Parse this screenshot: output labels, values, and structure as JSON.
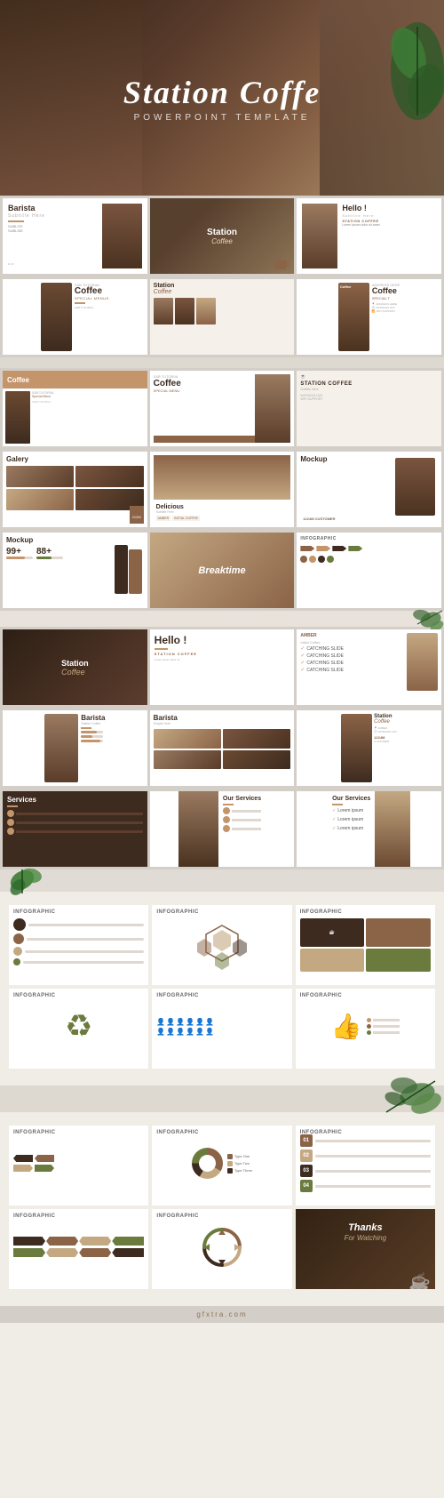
{
  "hero": {
    "title": "Station Coffe",
    "subtitle": "POWERPOINT TEMPLATE",
    "brand": "gfxtra.com"
  },
  "slides": {
    "row1": [
      {
        "id": "barista",
        "title": "Barista",
        "subtitle": "Subtitle Here",
        "tag1": "SUBLITE",
        "tag2": "SUBLISE"
      },
      {
        "id": "station-main",
        "title": "Station",
        "subtitle": "Coffee"
      },
      {
        "id": "hello",
        "title": "Hello",
        "subtitle": "Subtitle Here",
        "tag": "STATION COFFEE"
      }
    ],
    "row2": [
      {
        "id": "coffee-special",
        "title": "Coffee",
        "subtitle": "SPECIAL MENUS",
        "tag": "S&B TUTORIAL"
      },
      {
        "id": "station-coffee2",
        "title": "Station",
        "subtitle": "Coffee"
      },
      {
        "id": "coffee-address",
        "title": "Coffee",
        "subtitle": "SPECIAL T",
        "tag": "ADDRESS HERE"
      }
    ],
    "row3": [
      {
        "id": "coffee-a",
        "title": "Coffee",
        "subtitle": "Special Menu",
        "tag": "S&B TUTORIAL"
      },
      {
        "id": "coffee-b",
        "title": "Coffee",
        "subtitle": "SPECIAL MENU"
      },
      {
        "id": "station-logo",
        "title": "STATION COFFEE",
        "subtitle": "WORKING DAY",
        "stat": "WIFI SUPPORT"
      }
    ],
    "row4": [
      {
        "id": "gallery",
        "title": "Galery",
        "stat": "212M",
        "tag": "WORKING DAY"
      },
      {
        "id": "delicious",
        "title": "Delicious",
        "subtitle": "Subtitle Here",
        "tag1": "AMBER",
        "tag2": "INITIAL COFFEE"
      },
      {
        "id": "mockup2",
        "title": "Mockup",
        "stat": "1224M CUSTOMER"
      }
    ],
    "row5": [
      {
        "id": "mockup3",
        "title": "Mockup",
        "stat1": "99+",
        "stat2": "88+"
      },
      {
        "id": "breaktime",
        "title": "Breaktime"
      },
      {
        "id": "infographic1",
        "title": "INFOGRAPHIC"
      }
    ],
    "row6": [
      {
        "id": "station-dark",
        "title": "Station",
        "subtitle": "Coffee"
      },
      {
        "id": "hello2",
        "title": "Hello !"
      },
      {
        "id": "amber-check",
        "title": "AMBER",
        "checks": [
          "CATCHING SLIDE",
          "CATCHING SLIDE",
          "CATCHING SLIDE",
          "CATCHING SLIDE"
        ]
      }
    ],
    "row7": [
      {
        "id": "barista2",
        "title": "Barista",
        "subtitle": "Station Coffee"
      },
      {
        "id": "barista3",
        "title": "Barista",
        "subtitle": "Simple Here"
      },
      {
        "id": "station-stat",
        "title": "Station",
        "subtitle": "Coffee",
        "stat": "1224M CUSTOMER"
      }
    ],
    "row8": [
      {
        "id": "services1",
        "title": "Services"
      },
      {
        "id": "services2",
        "title": "Our Services"
      },
      {
        "id": "services3",
        "title": "Our Services"
      }
    ]
  },
  "infographics": {
    "row1": [
      {
        "title": "INFOGRAPHIC",
        "type": "circles"
      },
      {
        "title": "INFOGRAPHIC",
        "type": "hexagon"
      },
      {
        "title": "INFOGRAPHIC",
        "type": "boxes"
      }
    ],
    "row2": [
      {
        "title": "INFOGRAPHIC",
        "type": "recycle"
      },
      {
        "title": "INFOGRAPHIC",
        "type": "people"
      },
      {
        "title": "INFOGRAPHIC",
        "type": "thumbs"
      }
    ]
  },
  "bottom_infographics": {
    "row1": [
      {
        "title": "INFOGRAPHIC",
        "type": "arrows-left"
      },
      {
        "title": "INFOGRAPHIC",
        "type": "donut"
      },
      {
        "title": "INFOGRAPHIC",
        "type": "numbered"
      }
    ],
    "row2": [
      {
        "title": "INFOGRAPHIC",
        "type": "timeline"
      },
      {
        "title": "INFOGRAPHIC",
        "type": "circular"
      },
      {
        "id": "thanks",
        "title": "Thanks",
        "subtitle": "For Watching"
      }
    ]
  },
  "labels": {
    "station_coffee": "Station Coffee",
    "coffee": "Coffee",
    "barista": "Barista",
    "hello": "Hello !",
    "delicious": "Delicious",
    "mockup": "Mockup",
    "breaktime": "Breaktime",
    "infographic": "INFOGRAPHIC",
    "services": "Services",
    "our_services": "Our Services",
    "gallery": "Galery",
    "thanks": "Thanks",
    "for_watching": "For Watching",
    "subtitle_here": "Subtitle Here",
    "special_menu": "Special Menu",
    "powerpoint_template": "POWERPOINT TEMPLATE",
    "station_coffee_tag": "STATION COFFEE",
    "address_here": "ADDRESS HERE",
    "working_day": "WORKING DAY",
    "wifi_support": "WIFI SUPPORT"
  }
}
